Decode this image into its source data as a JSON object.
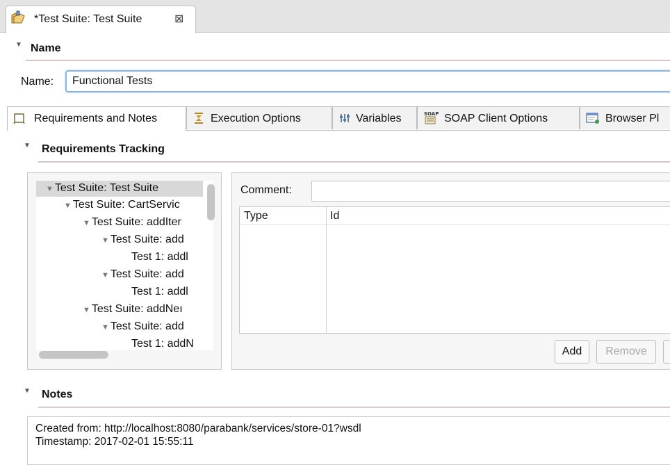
{
  "editor_tab": {
    "title": "*Test Suite: Test Suite",
    "close_glyph": "⊠"
  },
  "name_section": {
    "header": "Name",
    "field_label": "Name:",
    "field_value": "Functional Tests"
  },
  "tabs": [
    {
      "label": "Requirements and Notes",
      "icon": "requirements-icon"
    },
    {
      "label": "Execution Options",
      "icon": "execution-icon"
    },
    {
      "label": "Variables",
      "icon": "variables-icon"
    },
    {
      "label": "SOAP Client Options",
      "icon": "soap-icon"
    },
    {
      "label": "Browser Pl",
      "icon": "browser-icon"
    }
  ],
  "requirements": {
    "header": "Requirements Tracking",
    "tree": [
      {
        "label": "Test Suite: Test Suite",
        "expanded": true,
        "selected": true
      },
      {
        "label": "Test Suite: CartServic",
        "expanded": true
      },
      {
        "label": "Test Suite: addIter",
        "expanded": true
      },
      {
        "label": "Test Suite: add",
        "expanded": true
      },
      {
        "label": "Test 1: addl",
        "expanded": false
      },
      {
        "label": "Test Suite: add",
        "expanded": true
      },
      {
        "label": "Test 1: addl",
        "expanded": false
      },
      {
        "label": "Test Suite: addNeı",
        "expanded": true
      },
      {
        "label": "Test Suite: add",
        "expanded": true
      },
      {
        "label": "Test 1: addN",
        "expanded": false
      }
    ],
    "comment_label": "Comment:",
    "comment_value": "",
    "table_columns": [
      "Type",
      "Id"
    ],
    "add_button": "Add",
    "remove_button": "Remove"
  },
  "notes": {
    "header": "Notes",
    "line1": "Created from: http://localhost:8080/parabank/services/store-01?wsdl",
    "line2": "Timestamp: 2017-02-01 15:55:11"
  },
  "colors": {
    "accent_border": "#8ab4e6",
    "section_rule": "#c9b2b2"
  }
}
